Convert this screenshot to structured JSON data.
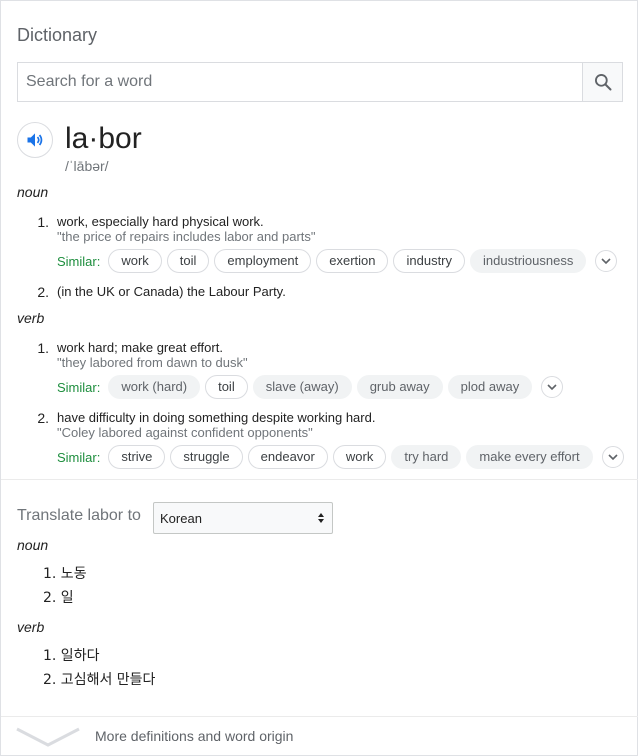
{
  "header": {
    "title": "Dictionary"
  },
  "search": {
    "placeholder": "Search for a word",
    "icon": "search-icon"
  },
  "entry": {
    "word": "la·bor",
    "phonetic": "/ˈlābər/",
    "speaker_icon": "speaker-icon",
    "noun": {
      "pos": "noun",
      "senses": [
        {
          "num": "1.",
          "definition": "work, especially hard physical work.",
          "example": "\"the price of repairs includes labor and parts\"",
          "similar_label": "Similar:",
          "similar": [
            {
              "text": "work",
              "style": "outlined"
            },
            {
              "text": "toil",
              "style": "outlined"
            },
            {
              "text": "employment",
              "style": "outlined"
            },
            {
              "text": "exertion",
              "style": "outlined"
            },
            {
              "text": "industry",
              "style": "outlined"
            },
            {
              "text": "industriousness",
              "style": "filled"
            }
          ]
        },
        {
          "num": "2.",
          "definition": "(in the UK or Canada) the Labour Party."
        }
      ]
    },
    "verb": {
      "pos": "verb",
      "senses": [
        {
          "num": "1.",
          "definition": "work hard; make great effort.",
          "example": "\"they labored from dawn to dusk\"",
          "similar_label": "Similar:",
          "similar": [
            {
              "text": "work (hard)",
              "style": "filled"
            },
            {
              "text": "toil",
              "style": "outlined"
            },
            {
              "text": "slave (away)",
              "style": "filled"
            },
            {
              "text": "grub away",
              "style": "filled"
            },
            {
              "text": "plod away",
              "style": "filled"
            }
          ]
        },
        {
          "num": "2.",
          "definition": "have difficulty in doing something despite working hard.",
          "example": "\"Coley labored against confident opponents\"",
          "similar_label": "Similar:",
          "similar": [
            {
              "text": "strive",
              "style": "outlined"
            },
            {
              "text": "struggle",
              "style": "outlined"
            },
            {
              "text": "endeavor",
              "style": "outlined"
            },
            {
              "text": "work",
              "style": "outlined"
            },
            {
              "text": "try hard",
              "style": "filled"
            },
            {
              "text": "make every effort",
              "style": "filled"
            }
          ]
        }
      ]
    }
  },
  "translate": {
    "label": "Translate labor to",
    "language": "Korean",
    "noun_label": "noun",
    "noun_items": [
      "1. 노동",
      "2. 일"
    ],
    "verb_label": "verb",
    "verb_items": [
      "1. 일하다",
      "2. 고심해서 만들다"
    ]
  },
  "footer": {
    "more_label": "More definitions and word origin"
  },
  "colors": {
    "similar_green": "#1e8e3e",
    "speaker_blue": "#1a73e8",
    "muted": "#70757a"
  }
}
